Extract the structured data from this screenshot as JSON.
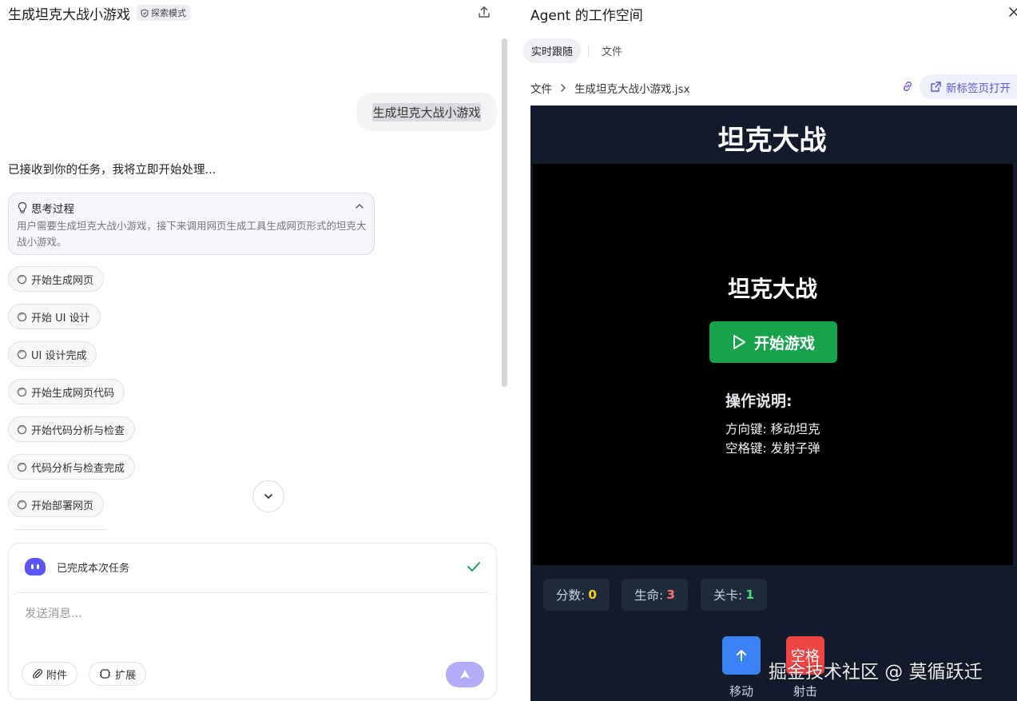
{
  "left": {
    "title": "生成坦克大战小游戏",
    "badge": "探索模式",
    "user_message": "生成坦克大战小游戏",
    "ack": "已接收到你的任务，我将立即开始处理...",
    "thinking": {
      "title": "思考过程",
      "body": "用户需要生成坦克大战小游戏，接下来调用网页生成工具生成网页形式的坦克大战小游戏。"
    },
    "steps": [
      "开始生成网页",
      "开始 UI 设计",
      "UI 设计完成",
      "开始生成网页代码",
      "开始代码分析与检查",
      "代码分析与检查完成",
      "开始部署网页"
    ],
    "done_text": "已完成本次任务",
    "input_placeholder": "发送消息...",
    "attach_label": "附件",
    "extend_label": "扩展"
  },
  "right": {
    "title": "Agent 的工作空间",
    "tabs": [
      "实时跟随",
      "文件"
    ],
    "breadcrumb": [
      "文件",
      "生成坦克大战小游戏.jsx"
    ],
    "new_tab_label": "新标签页打开"
  },
  "game": {
    "header": "坦克大战",
    "canvas_title": "坦克大战",
    "start_label": "开始游戏",
    "instructions_title": "操作说明:",
    "instructions": [
      "方向键: 移动坦克",
      "空格键: 发射子弹"
    ],
    "stats": [
      {
        "label": "分数:",
        "value": "0",
        "color": "#facc15"
      },
      {
        "label": "生命:",
        "value": "3",
        "color": "#f87171"
      },
      {
        "label": "关卡:",
        "value": "1",
        "color": "#4ade80"
      }
    ],
    "controls": [
      {
        "key": "↑",
        "label": "移动",
        "color": "#3b82f6"
      },
      {
        "key": "空格",
        "label": "射击",
        "color": "#ef4444"
      }
    ]
  },
  "watermark": "掘金技术社区 @ 莫循跃迁",
  "colors": {
    "accent": "#5b55f6",
    "send": "#b3acf8",
    "game_bg": "#121a2b",
    "start_btn": "#16a34a"
  }
}
